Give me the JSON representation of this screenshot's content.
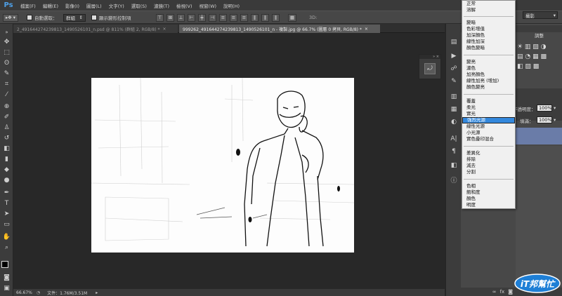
{
  "app": {
    "logo": "Ps"
  },
  "menubar": [
    "檔案(F)",
    "編輯(E)",
    "影像(I)",
    "圖層(L)",
    "文字(Y)",
    "選取(S)",
    "濾鏡(T)",
    "檢視(V)",
    "視窗(W)",
    "說明(H)"
  ],
  "options": {
    "auto_select_label": "自動選取：",
    "auto_select_value": "群組",
    "transform_controls_label": "顯示變形控制項"
  },
  "tabs": [
    {
      "label": "2_491644274239813_1490526101_n.psd @ 811% (群組 2, RGB/8) *",
      "close": "×",
      "active": false
    },
    {
      "label": "999262_491644274239813_1490526101_n - 複製.jpg @ 66.7% (圖層 0 拷貝, RGB/8) *",
      "close": "×",
      "active": true
    }
  ],
  "blend_menu": {
    "groups": [
      [
        "正常",
        "溶解"
      ],
      [
        "變暗",
        "色彩增值",
        "加深顏色",
        "線性加深",
        "顏色變暗"
      ],
      [
        "變亮",
        "濾色",
        "加亮顏色",
        "線性加亮 (增加)",
        "顏色變亮"
      ],
      [
        "覆蓋",
        "柔光",
        "實光",
        "強烈光源",
        "線性光源",
        "小光源",
        "實色疊印混合"
      ],
      [
        "差異化",
        "排除",
        "減去",
        "分割"
      ],
      [
        "色相",
        "飽和度",
        "顏色",
        "明度"
      ]
    ],
    "selected": "強烈光源"
  },
  "right_panel": {
    "workspace_value": "攝影",
    "adjust_tab": "調整",
    "opacity_label": "不透明度：",
    "opacity_value": "100%",
    "fill_label": "填滿：",
    "fill_value": "100%"
  },
  "statusbar": {
    "zoom": "66.67%",
    "doc_size": "文件：1.76M/3.51M"
  },
  "watermark": {
    "text": "iT邦幫忙"
  },
  "colors": {
    "accent": "#3388dd",
    "ps_blue": "#4ea0e8"
  }
}
